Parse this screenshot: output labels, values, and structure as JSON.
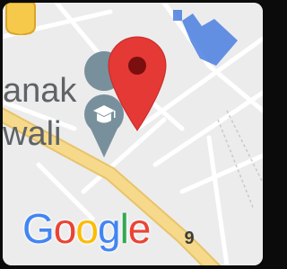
{
  "map": {
    "place_label_lines": [
      "anak",
      "wali"
    ],
    "brand": {
      "letters": [
        "G",
        "o",
        "o",
        "g",
        "l",
        "e"
      ],
      "colors": [
        "#4285F4",
        "#EA4335",
        "#FBBC05",
        "#4285F4",
        "#34A853",
        "#EA4335"
      ]
    },
    "route_shield": "9",
    "colors": {
      "background": "#ececec",
      "road": "#ffffff",
      "highway": "#f6d98a",
      "pin": "#e53935",
      "school_icon": "#78909c",
      "building_blue": "#4a7fe0"
    }
  }
}
